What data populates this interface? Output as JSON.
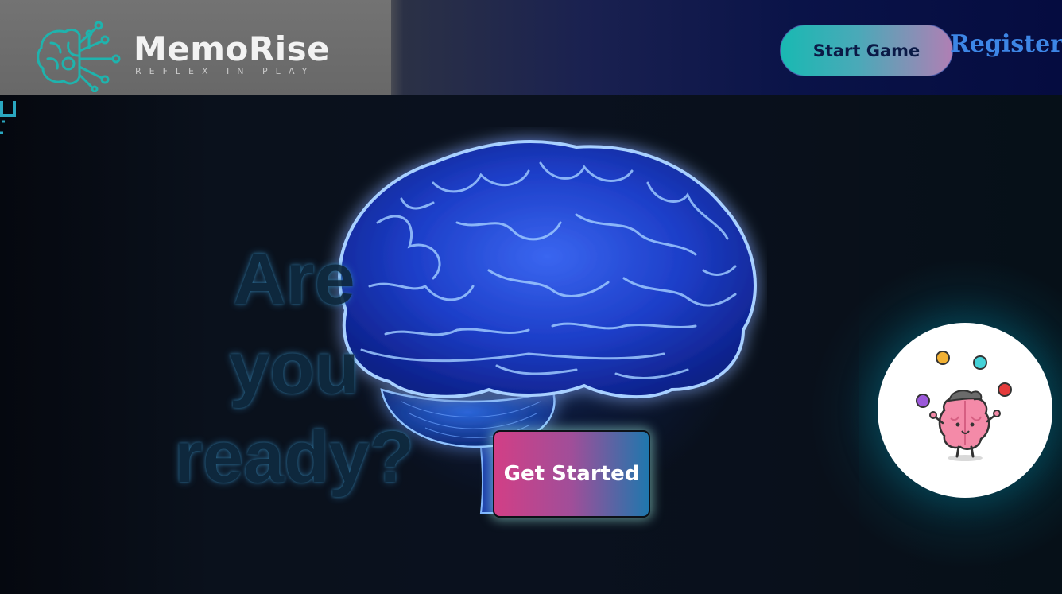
{
  "brand": {
    "name": "MemoRise",
    "tagline": "REFLEX IN PLAY",
    "logo_icon": "brain-circuit-icon",
    "accent_color": "#19b9b2"
  },
  "nav": {
    "start_game_label": "Start Game",
    "register_label": "Register"
  },
  "hero": {
    "headline_lines": [
      "Are",
      "you",
      "ready?"
    ],
    "cta_label": "Get Started",
    "image": "glowing-blue-brain",
    "mascot": "juggling-brain-mascot"
  },
  "colors": {
    "header_dark": "#050c40",
    "logo_panel": "#6d6d6d",
    "brain_glow": "#2e6dff",
    "cta_pink": "#d23f86",
    "cta_blue": "#1f77ad",
    "register_blue": "#3d86e6"
  }
}
